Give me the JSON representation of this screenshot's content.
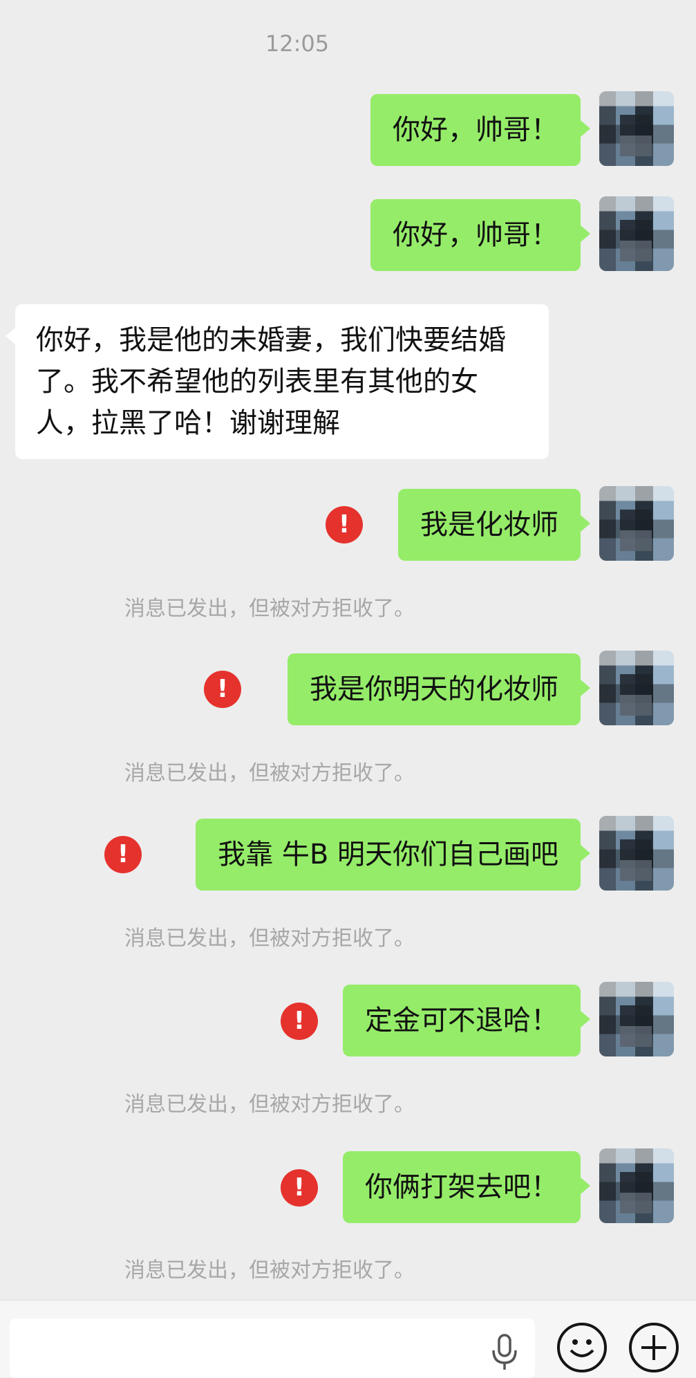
{
  "chat": {
    "timestamp": "12:05",
    "messages": [
      {
        "text": "你好，帅哥！"
      },
      {
        "text": "你好，帅哥！"
      },
      {
        "text": "你好，我是他的未婚妻，我们快要结婚了。我不希望他的列表里有其他的女人，拉黑了哈！谢谢理解"
      },
      {
        "text": "我是化妆师",
        "notice": "消息已发出，但被对方拒收了。"
      },
      {
        "text": "我是你明天的化妆师",
        "notice": "消息已发出，但被对方拒收了。"
      },
      {
        "text": "我靠 牛B 明天你们自己画吧",
        "notice": "消息已发出，但被对方拒收了。"
      },
      {
        "text": "定金可不退哈！",
        "notice": "消息已发出，但被对方拒收了。"
      },
      {
        "text": "你俩打架去吧！",
        "notice": "消息已发出，但被对方拒收了。"
      }
    ],
    "alert_symbol": "!"
  },
  "footer": {
    "icons": [
      "microphone-icon",
      "emoji-icon",
      "plus-icon"
    ]
  },
  "colors": {
    "outgoing_bubble": "#95ec69",
    "incoming_bubble": "#ffffff",
    "background": "#ededed",
    "alert": "#e5322d",
    "notice_text": "#a7a7a7"
  }
}
